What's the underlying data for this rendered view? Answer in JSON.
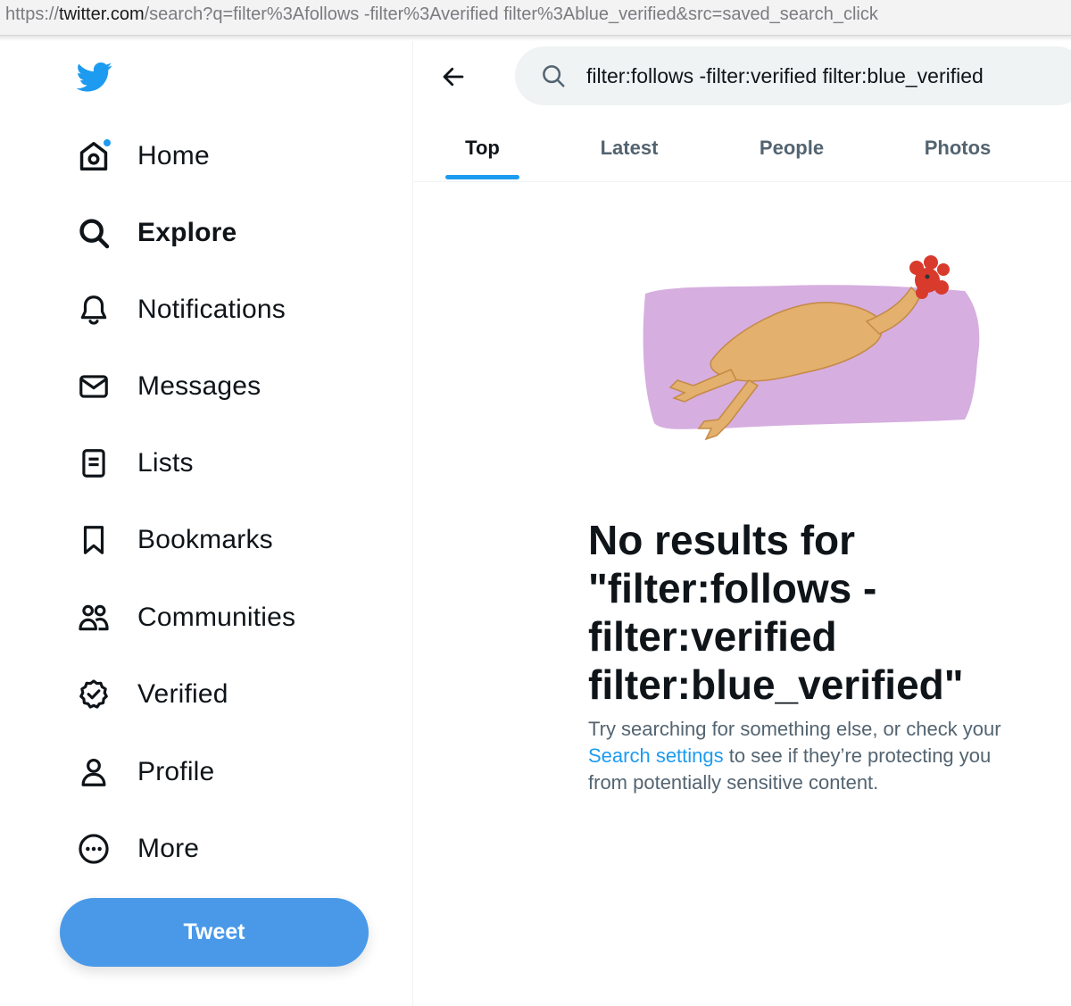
{
  "browser": {
    "url_scheme": "https://",
    "url_host": "twitter.com",
    "url_rest": "/search?q=filter%3Afollows -filter%3Averified filter%3Ablue_verified&src=saved_search_click"
  },
  "sidebar": {
    "logo_icon": "twitter-bird-icon",
    "items": [
      {
        "label": "Home",
        "icon": "home-icon"
      },
      {
        "label": "Explore",
        "icon": "search-icon"
      },
      {
        "label": "Notifications",
        "icon": "bell-icon"
      },
      {
        "label": "Messages",
        "icon": "mail-icon"
      },
      {
        "label": "Lists",
        "icon": "list-icon"
      },
      {
        "label": "Bookmarks",
        "icon": "bookmark-icon"
      },
      {
        "label": "Communities",
        "icon": "people-icon"
      },
      {
        "label": "Verified",
        "icon": "verified-badge-icon"
      },
      {
        "label": "Profile",
        "icon": "person-icon"
      },
      {
        "label": "More",
        "icon": "more-circle-icon"
      }
    ],
    "tweet_button": "Tweet"
  },
  "header": {
    "back_icon": "arrow-left-icon",
    "search_value": "filter:follows -filter:verified filter:blue_verified"
  },
  "tabs": [
    {
      "label": "Top"
    },
    {
      "label": "Latest"
    },
    {
      "label": "People"
    },
    {
      "label": "Photos"
    }
  ],
  "empty_state": {
    "illustration": "rubber-chicken-illustration",
    "title_prefix": "No results for ",
    "title_query": "\"filter:follows -filter:verified filter:blue_verified\"",
    "sub_before": "Try searching for something else, or check your ",
    "sub_link": "Search settings",
    "sub_after": " to see if they’re protecting you from potentially sensitive content."
  },
  "colors": {
    "accent": "#1d9bf0",
    "tweet_button": "#4a99e9",
    "illustration_background": "#d6aee0",
    "chicken_body": "#e3b06e",
    "chicken_comb": "#d83a2c"
  }
}
